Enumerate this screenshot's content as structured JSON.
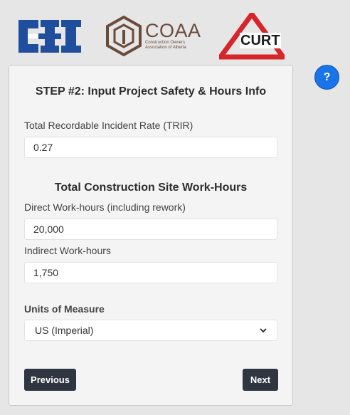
{
  "logos": {
    "cii": "CII",
    "coaa": {
      "main": "COAA",
      "sub_line1": "Construction Owners",
      "sub_line2": "Association of Alberta"
    },
    "curt": "CURT"
  },
  "help": {
    "label": "?"
  },
  "step": {
    "title": "STEP #2: Input Project Safety & Hours Info"
  },
  "trir": {
    "label": "Total Recordable Incident Rate (TRIR)",
    "value": "0.27"
  },
  "hours": {
    "section_title": "Total Construction Site Work-Hours",
    "direct_label": "Direct Work-hours (including rework)",
    "direct_value": "20,000",
    "indirect_label": "Indirect Work-hours",
    "indirect_value": "1,750"
  },
  "units": {
    "label": "Units of Measure",
    "selected": "US (Imperial)"
  },
  "nav": {
    "previous_label": "Previous",
    "next_label": "Next"
  },
  "colors": {
    "cii_blue": "#1f4f9c",
    "coaa_brown": "#6b4a3a",
    "curt_red": "#d7262a",
    "help_blue": "#1a73e8",
    "button_dark": "#2f3541"
  }
}
